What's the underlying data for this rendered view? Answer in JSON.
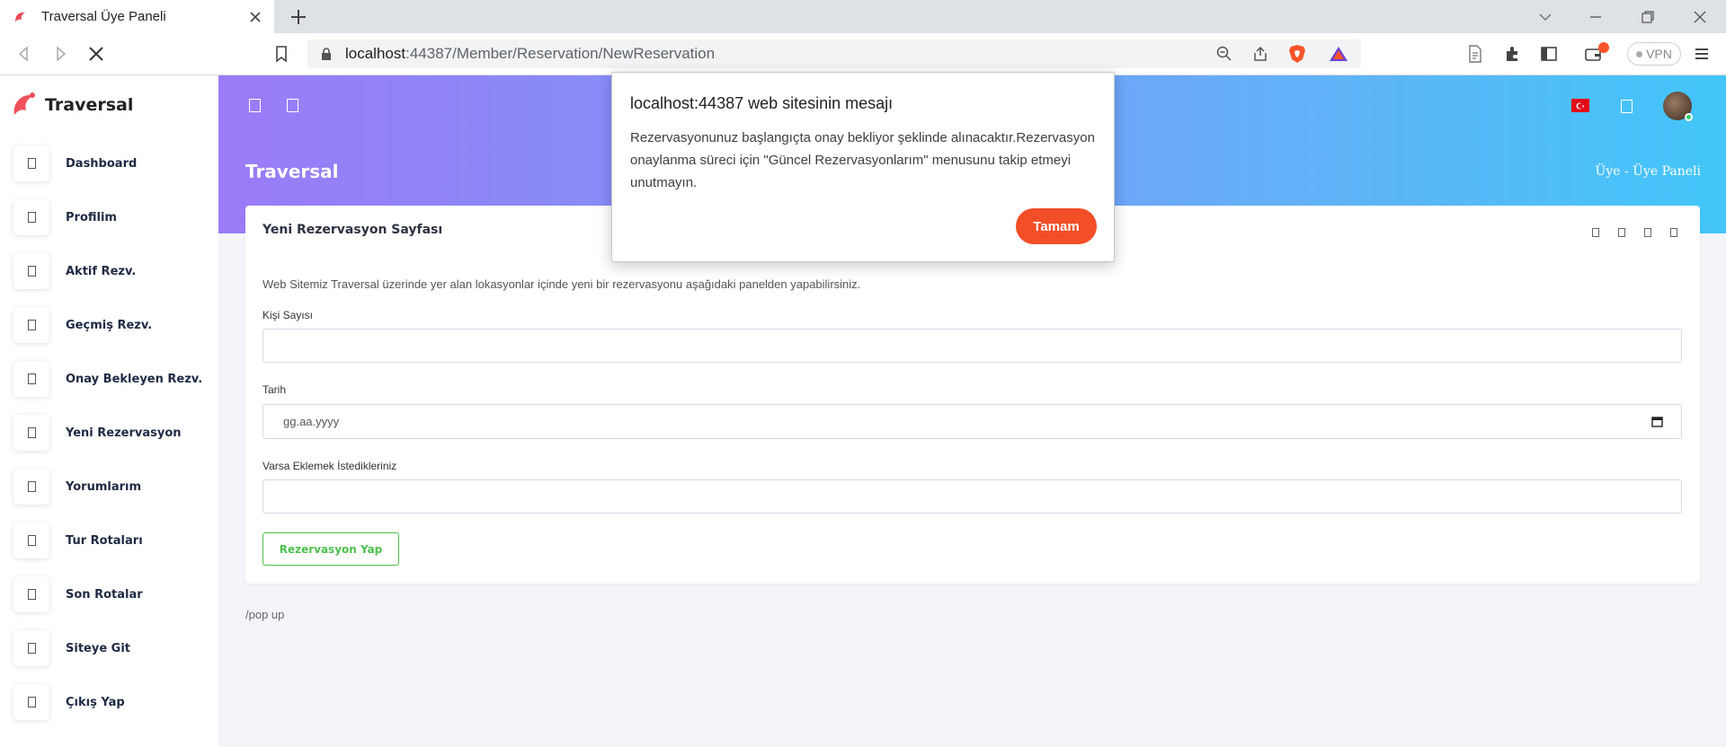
{
  "browser": {
    "tab_title": "Traversal Üye Paneli",
    "url_host": "localhost",
    "url_path": ":44387/Member/Reservation/NewReservation",
    "vpn_label": "VPN"
  },
  "sidebar": {
    "brand": "Traversal",
    "items": [
      {
        "label": "Dashboard"
      },
      {
        "label": "Profilim"
      },
      {
        "label": "Aktif Rezv."
      },
      {
        "label": "Geçmiş Rezv."
      },
      {
        "label": "Onay Bekleyen Rezv."
      },
      {
        "label": "Yeni Rezervasyon"
      },
      {
        "label": "Yorumlarım"
      },
      {
        "label": "Tur Rotaları"
      },
      {
        "label": "Son Rotalar"
      },
      {
        "label": "Siteye Git"
      },
      {
        "label": "Çıkış Yap"
      }
    ]
  },
  "header": {
    "page_title": "Traversal",
    "breadcrumb": "Üye  -  Üye Paneli",
    "gradient_start": "#9b7bf8",
    "gradient_end": "#42c6fa"
  },
  "card": {
    "title": "Yeni Rezervasyon Sayfası",
    "intro": "Web Sitemiz Traversal üzerinde yer alan lokasyonlar içinde yeni bir rezervasyonu aşağıdaki panelden yapabilirsiniz.",
    "fields": {
      "person_count_label": "Kişi Sayısı",
      "date_label": "Tarih",
      "date_placeholder": "gg.aa.yyyy",
      "notes_label": "Varsa Eklemek İstedikleriniz"
    },
    "submit_label": "Rezervasyon Yap"
  },
  "popup_note": "/pop up",
  "dialog": {
    "title": "localhost:44387 web sitesinin mesajı",
    "message": "Rezervasyonunuz başlangıçta onay bekliyor şeklinde alınacaktır.Rezervasyon onaylanma süreci için \"Güncel Rezervasyonlarım\" menusunu takip etmeyi unutmayın.",
    "ok_label": "Tamam",
    "ok_color": "#f24e27"
  }
}
